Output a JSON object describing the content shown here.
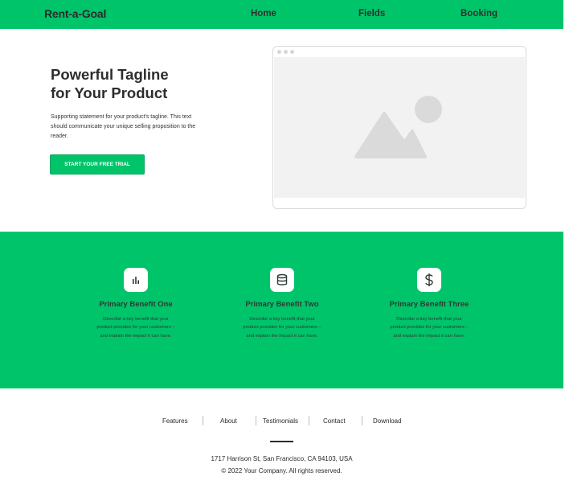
{
  "header": {
    "logo": "Rent-a-Goal",
    "nav": [
      "Home",
      "Fields",
      "Booking"
    ]
  },
  "hero": {
    "tagline_line1": "Powerful Tagline",
    "tagline_line2": "for Your Product",
    "support": "Supporting statement for your product's tagline. This text should communicate your unique selling proposition to the reader.",
    "cta": "START YOUR FREE TRIAL",
    "image_placeholder_icon": "image-icon"
  },
  "benefits": [
    {
      "icon": "bar-chart-icon",
      "title": "Primary Benefit One",
      "desc": "Describe a key benefit that your product provides for your customers – and explain the impact it can have."
    },
    {
      "icon": "database-icon",
      "title": "Primary Benefit Two",
      "desc": "Describe a key benefit that your product provides for your customers – and explain the impact it can have."
    },
    {
      "icon": "dollar-icon",
      "title": "Primary Benefit Three",
      "desc": "Describe a key benefit that your product provides for your customers – and explain the impact it can have."
    }
  ],
  "footer": {
    "links": [
      "Features",
      "About",
      "Testimonials",
      "Contact",
      "Download"
    ],
    "address": "1717 Harrison St, San Francisco, CA 94103, USA",
    "copyright": "© 2022 Your Company.  All rights reserved."
  },
  "colors": {
    "accent": "#00c46a",
    "text": "#2b2b2b",
    "placeholder": "#f2f2f2"
  }
}
